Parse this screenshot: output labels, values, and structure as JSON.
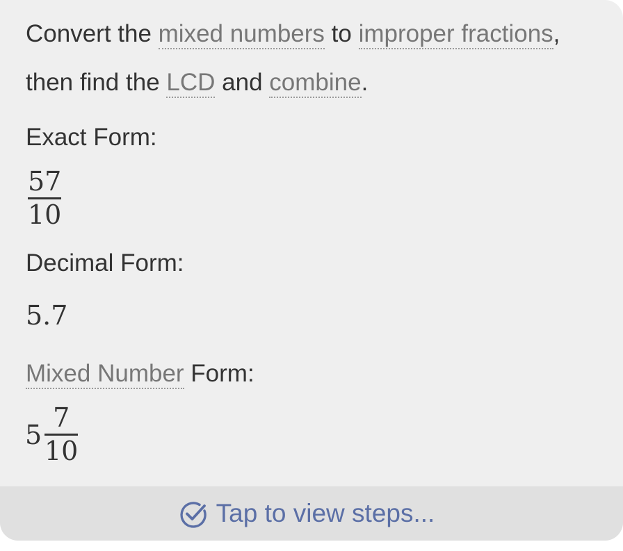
{
  "explanation": {
    "line1": {
      "t1": "Convert the ",
      "term1": "mixed numbers",
      "t2": " to ",
      "term2": "improper fractions",
      "t3": ","
    },
    "line2": {
      "t1": "then find the ",
      "term1": "LCD",
      "t2": " and ",
      "term2": "combine",
      "t3": "."
    }
  },
  "exact_form": {
    "label": "Exact Form:",
    "numerator": "57",
    "denominator": "10"
  },
  "decimal_form": {
    "label": "Decimal Form:",
    "value": "5.7"
  },
  "mixed_form": {
    "term": "Mixed Number",
    "label_rest": " Form:",
    "whole": "5",
    "numerator": "7",
    "denominator": "10"
  },
  "steps": {
    "label": "Tap to view steps...",
    "icon": "check-circle-icon",
    "color": "#5b6fa6"
  }
}
